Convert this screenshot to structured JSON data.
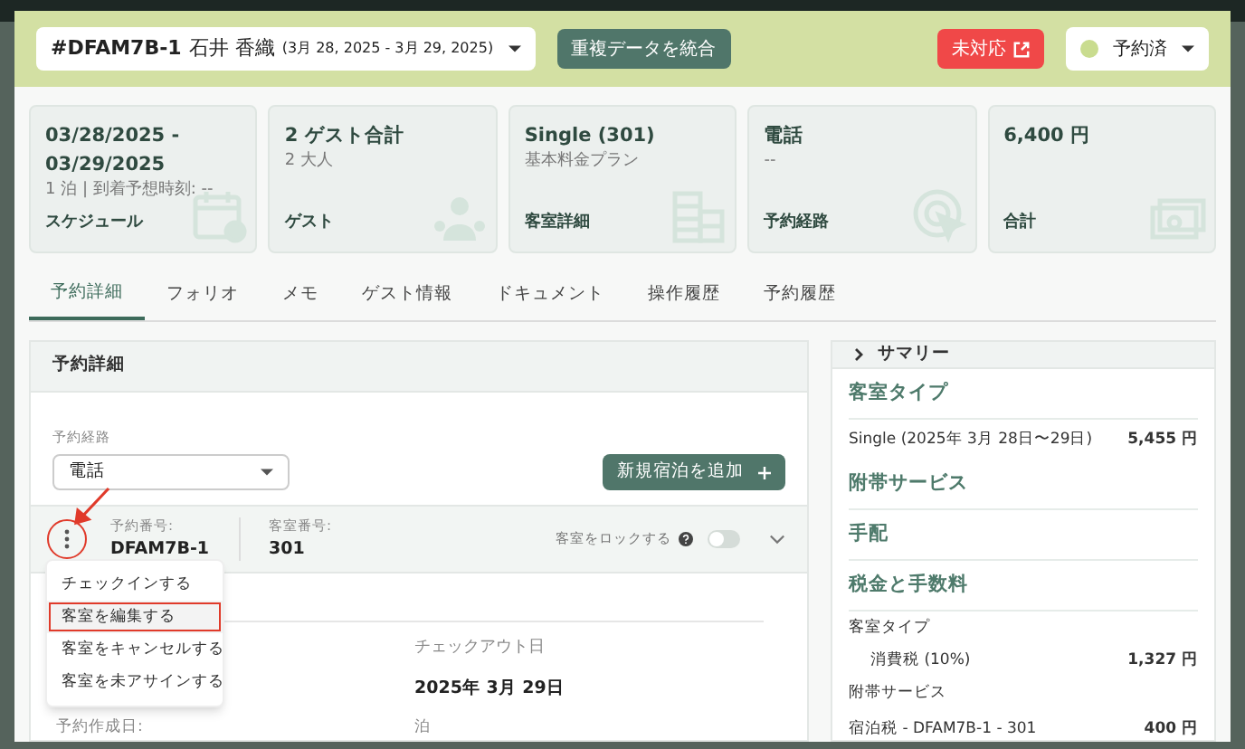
{
  "header": {
    "booking_select": {
      "code": "#DFAM7B-1",
      "guest": "石井 香織",
      "dates": "(3月 28, 2025 - 3月 29, 2025)"
    },
    "merge_button": "重複データを統合",
    "alert_button": "未対応",
    "status_select": {
      "label": "予約済",
      "color": "#c9dc8f"
    }
  },
  "cards": [
    {
      "kind": "schedule",
      "title": "03/28/2025 - 03/29/2025",
      "sub": "1 泊 | 到着予想時刻: --",
      "label": "スケジュール"
    },
    {
      "kind": "guests",
      "title": "2 ゲスト合計",
      "sub": "2 大人",
      "label": "ゲスト"
    },
    {
      "kind": "room",
      "title": "Single (301)",
      "sub": "基本料金プラン",
      "label": "客室詳細"
    },
    {
      "kind": "channel",
      "title": "電話",
      "sub": "--",
      "label": "予約経路"
    },
    {
      "kind": "total",
      "title": "6,400 円",
      "label": "合計"
    }
  ],
  "tabs": [
    {
      "label": "予約詳細",
      "selected": true
    },
    {
      "label": "フォリオ",
      "selected": false
    },
    {
      "label": "メモ",
      "selected": false
    },
    {
      "label": "ゲスト情報",
      "selected": false
    },
    {
      "label": "ドキュメント",
      "selected": false
    },
    {
      "label": "操作履歴",
      "selected": false
    },
    {
      "label": "予約履歴",
      "selected": false
    }
  ],
  "details": {
    "title": "予約詳細",
    "channel_label": "予約経路",
    "channel_value": "電話",
    "add_button": "新規宿泊を追加",
    "room": {
      "number_label": "予約番号:",
      "number": "DFAM7B-1",
      "room_label": "客室番号:",
      "room": "301",
      "lock_label": "客室をロックする",
      "locked": false
    },
    "menu": [
      {
        "label": "チェックインする",
        "selected": false
      },
      {
        "label": "客室を編集する",
        "selected": true
      },
      {
        "label": "客室をキャンセルする",
        "selected": false
      },
      {
        "label": "客室を未アサインする",
        "selected": false
      }
    ],
    "checkout_label": "チェックアウト日",
    "checkout_value": "2025年 3月 29日",
    "created_label": "予約作成日:",
    "nights_label": "泊"
  },
  "summary": {
    "title": "サマリー",
    "sections": [
      {
        "kind": "heading",
        "label": "客室タイプ"
      },
      {
        "kind": "line",
        "label": "Single (2025年 3月 28日〜29日)",
        "amount": "5,455 円"
      },
      {
        "kind": "heading",
        "label": "附帯サービス"
      },
      {
        "kind": "heading",
        "label": "手配"
      },
      {
        "kind": "heading",
        "label": "税金と手数料"
      },
      {
        "kind": "sub",
        "label": "客室タイプ"
      },
      {
        "kind": "indent",
        "label": "消費税 (10%)",
        "amount": "1,327 円"
      },
      {
        "kind": "sub",
        "label": "附帯サービス"
      },
      {
        "kind": "line",
        "label": "宿泊税 - DFAM7B-1 - 301",
        "amount": "400 円"
      }
    ]
  }
}
